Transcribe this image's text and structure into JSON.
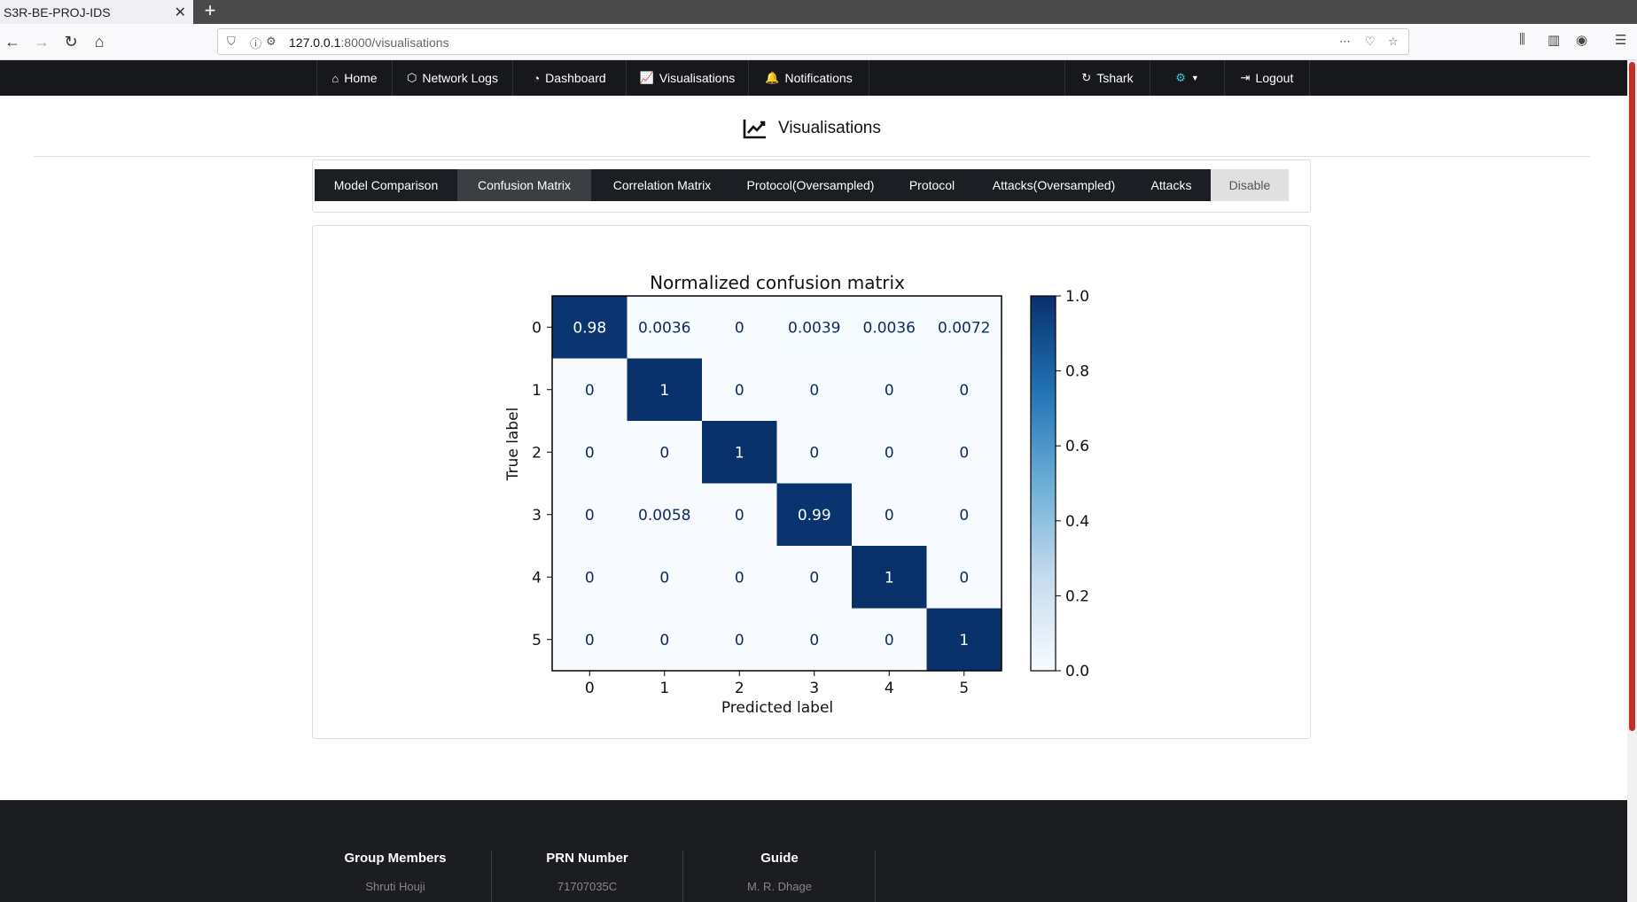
{
  "browser": {
    "tab_title": "S3R-BE-PROJ-IDS",
    "url_host": "127.0.0.1",
    "url_rest": ":8000/visualisations"
  },
  "nav": {
    "home": "Home",
    "network_logs": "Network Logs",
    "dashboard": "Dashboard",
    "visualisations": "Visualisations",
    "notifications": "Notifications",
    "tshark": "Tshark",
    "logout": "Logout"
  },
  "page": {
    "title": "Visualisations"
  },
  "tabs": [
    {
      "label": "Model Comparison",
      "active": false
    },
    {
      "label": "Confusion Matrix",
      "active": true
    },
    {
      "label": "Correlation Matrix",
      "active": false
    },
    {
      "label": "Protocol(Oversampled)",
      "active": false
    },
    {
      "label": "Protocol",
      "active": false
    },
    {
      "label": "Attacks(Oversampled)",
      "active": false
    },
    {
      "label": "Attacks",
      "active": false
    },
    {
      "label": "Disable",
      "active": false
    }
  ],
  "chart_data": {
    "type": "heatmap",
    "title": "Normalized confusion matrix",
    "xlabel": "Predicted label",
    "ylabel": "True label",
    "x_ticks": [
      "0",
      "1",
      "2",
      "3",
      "4",
      "5"
    ],
    "y_ticks": [
      "0",
      "1",
      "2",
      "3",
      "4",
      "5"
    ],
    "values": [
      [
        0.98,
        0.0036,
        0,
        0.0039,
        0.0036,
        0.0072
      ],
      [
        0,
        1,
        0,
        0,
        0,
        0
      ],
      [
        0,
        0,
        1,
        0,
        0,
        0
      ],
      [
        0,
        0.0058,
        0,
        0.99,
        0,
        0
      ],
      [
        0,
        0,
        0,
        0,
        1,
        0
      ],
      [
        0,
        0,
        0,
        0,
        0,
        1
      ]
    ],
    "labels": [
      [
        "0.98",
        "0.0036",
        "0",
        "0.0039",
        "0.0036",
        "0.0072"
      ],
      [
        "0",
        "1",
        "0",
        "0",
        "0",
        "0"
      ],
      [
        "0",
        "0",
        "1",
        "0",
        "0",
        "0"
      ],
      [
        "0",
        "0.0058",
        "0",
        "0.99",
        "0",
        "0"
      ],
      [
        "0",
        "0",
        "0",
        "0",
        "1",
        "0"
      ],
      [
        "0",
        "0",
        "0",
        "0",
        "0",
        "1"
      ]
    ],
    "colorbar": {
      "range": [
        0,
        1
      ],
      "ticks": [
        "0.0",
        "0.2",
        "0.4",
        "0.6",
        "0.8",
        "1.0"
      ]
    },
    "colormap": {
      "low": "#f7fbff",
      "high": "#08306b"
    }
  },
  "footer": {
    "group_members_label": "Group Members",
    "group_members_value": "Shruti Houji",
    "prn_label": "PRN Number",
    "prn_value": "71707035C",
    "guide_label": "Guide",
    "guide_value": "M. R. Dhage"
  }
}
